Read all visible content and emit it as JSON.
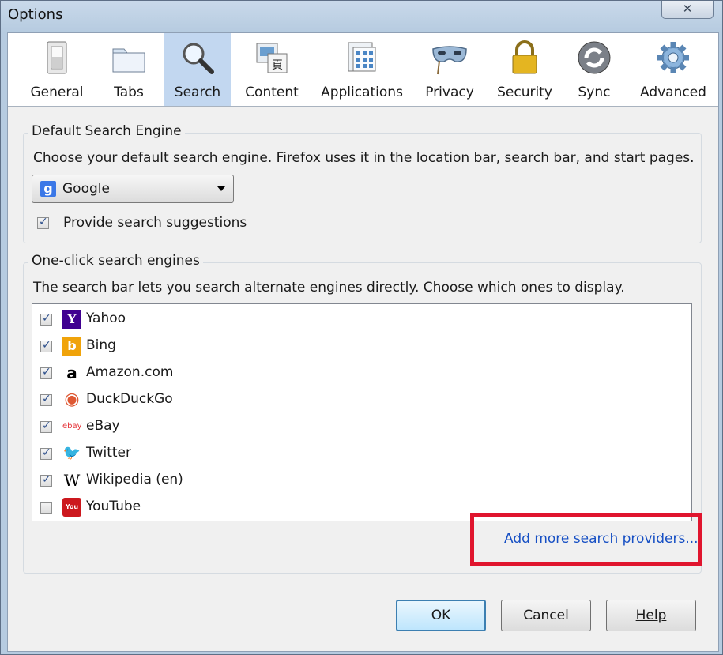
{
  "window": {
    "title": "Options",
    "close_glyph": "✕"
  },
  "toolbar": {
    "panes": [
      {
        "id": "general",
        "label": "General",
        "icon": "light-switch-icon",
        "selected": false
      },
      {
        "id": "tabs",
        "label": "Tabs",
        "icon": "folder-tabs-icon",
        "selected": false
      },
      {
        "id": "search",
        "label": "Search",
        "icon": "magnifier-icon",
        "selected": true
      },
      {
        "id": "content",
        "label": "Content",
        "icon": "content-icon",
        "selected": false
      },
      {
        "id": "applications",
        "label": "Applications",
        "icon": "applications-icon",
        "selected": false
      },
      {
        "id": "privacy",
        "label": "Privacy",
        "icon": "mask-icon",
        "selected": false
      },
      {
        "id": "security",
        "label": "Security",
        "icon": "padlock-icon",
        "selected": false
      },
      {
        "id": "sync",
        "label": "Sync",
        "icon": "sync-arrows-icon",
        "selected": false
      },
      {
        "id": "advanced",
        "label": "Advanced",
        "icon": "gear-icon",
        "selected": false
      }
    ]
  },
  "default_engine": {
    "caption": "Default Search Engine",
    "description": "Choose your default search engine. Firefox uses it in the location bar, search bar, and start pages.",
    "selected": "Google",
    "selected_icon_letter": "g",
    "suggestions_label": "Provide search suggestions",
    "suggestions_checked": true
  },
  "one_click": {
    "caption": "One-click search engines",
    "description": "The search bar lets you search alternate engines directly. Choose which ones to display.",
    "engines": [
      {
        "name": "Yahoo",
        "checked": true,
        "icon": "yahoo-icon",
        "glyph": "Y",
        "color": "#400090"
      },
      {
        "name": "Bing",
        "checked": true,
        "icon": "bing-icon",
        "glyph": "b",
        "color": "#f0a30a"
      },
      {
        "name": "Amazon.com",
        "checked": true,
        "icon": "amazon-icon",
        "glyph": "a",
        "color": "#000000"
      },
      {
        "name": "DuckDuckGo",
        "checked": true,
        "icon": "duckduckgo-icon",
        "glyph": "◉",
        "color": "#de5833"
      },
      {
        "name": "eBay",
        "checked": true,
        "icon": "ebay-icon",
        "glyph": "ebay",
        "color": "#e53238"
      },
      {
        "name": "Twitter",
        "checked": true,
        "icon": "twitter-icon",
        "glyph": "🐦",
        "color": "#1da1f2"
      },
      {
        "name": "Wikipedia (en)",
        "checked": true,
        "icon": "wikipedia-icon",
        "glyph": "W",
        "color": "#000000"
      },
      {
        "name": "YouTube",
        "checked": false,
        "icon": "youtube-icon",
        "glyph": "You",
        "color": "#cc181e"
      }
    ],
    "add_more_link": "Add more search providers..."
  },
  "buttons": {
    "ok": "OK",
    "cancel": "Cancel",
    "help": "Help"
  },
  "colors": {
    "selected_pane": "#c2d7f0",
    "link": "#1750c4",
    "highlight_box": "#e0152e"
  }
}
